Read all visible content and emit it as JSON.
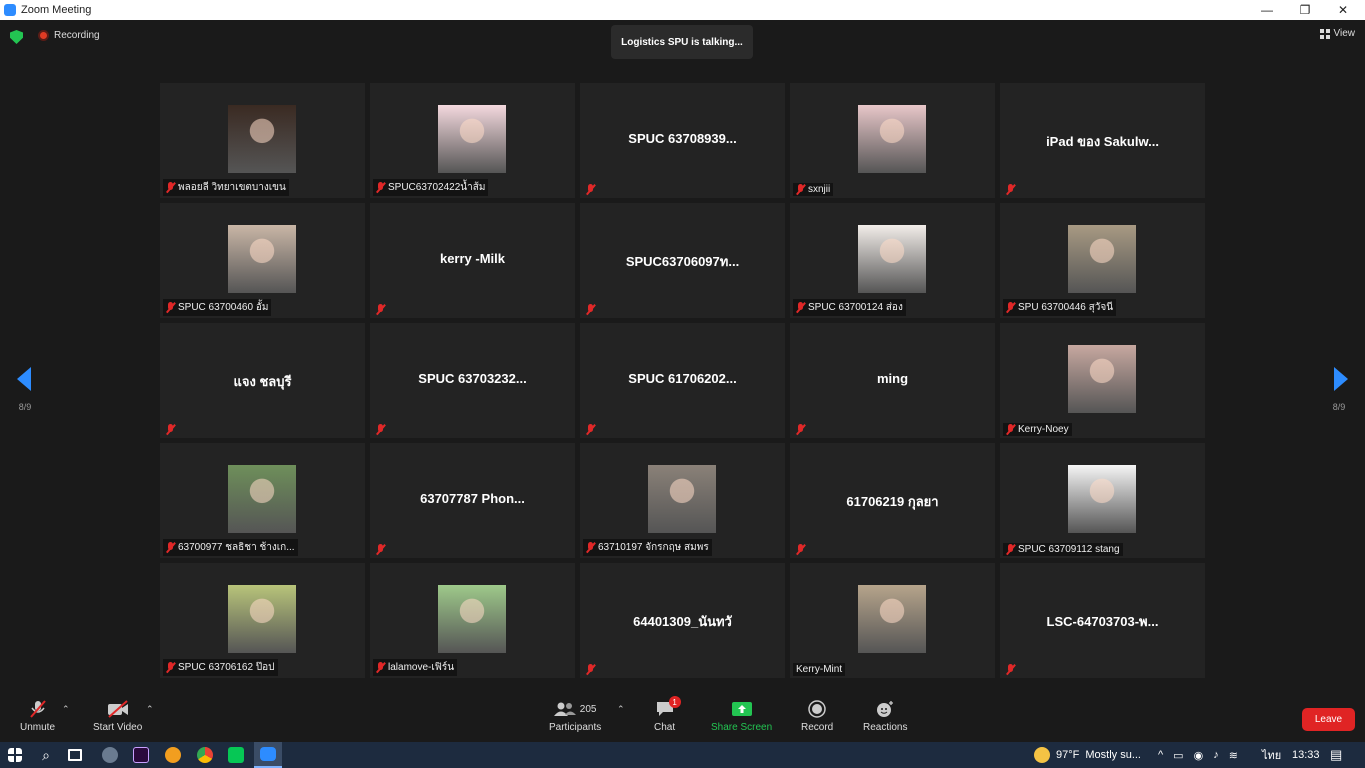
{
  "window": {
    "title": "Zoom Meeting",
    "minimize": "—",
    "restore": "❐",
    "close": "✕"
  },
  "header": {
    "recording_label": "Recording",
    "talking_banner": "Logistics SPU is talking...",
    "view_label": "View"
  },
  "pager": {
    "left_page": "8/9",
    "right_page": "8/9"
  },
  "tiles": [
    {
      "name": "พลอยลี วิทยาเขตบางเขน",
      "muted": true,
      "photo_color": "#3a2a22"
    },
    {
      "name": "SPUC63702422น้ำส้ม",
      "muted": true,
      "photo_color": "#f4d9de"
    },
    {
      "name": "",
      "display_name": "SPUC 63708939...",
      "muted": true
    },
    {
      "name": "sxnjii",
      "muted": true,
      "photo_color": "#e8c7c9"
    },
    {
      "name": "",
      "display_name": "iPad ของ Sakulw...",
      "muted": true
    },
    {
      "name": "SPUC 63700460 อั้ม",
      "muted": true,
      "photo_color": "#c9b6a6"
    },
    {
      "name": "",
      "display_name": "kerry -Milk",
      "muted": true
    },
    {
      "name": "",
      "display_name": "SPUC63706097ท...",
      "muted": true
    },
    {
      "name": "SPUC 63700124 ส่อง",
      "muted": true,
      "photo_color": "#f2ede9"
    },
    {
      "name": "SPU 63700446 สุวัจนี",
      "muted": true,
      "photo_color": "#a89a83"
    },
    {
      "name": "",
      "display_name": "แจง ชลบุรี",
      "muted": true
    },
    {
      "name": "",
      "display_name": "SPUC 63703232...",
      "muted": true
    },
    {
      "name": "",
      "display_name": "SPUC 61706202...",
      "muted": true
    },
    {
      "name": "",
      "display_name": "ming",
      "muted": true
    },
    {
      "name": "Kerry-Noey",
      "muted": true,
      "photo_color": "#c7a8a0"
    },
    {
      "name": "63700977 ชลธิชา ช้างเก...",
      "muted": true,
      "photo_color": "#6e8f5a"
    },
    {
      "name": "",
      "display_name": "63707787 Phon...",
      "muted": true
    },
    {
      "name": "63710197 จักรกฤษ สมพร",
      "muted": true,
      "photo_color": "#8a8178"
    },
    {
      "name": "",
      "display_name": "61706219 กุลยา",
      "muted": true
    },
    {
      "name": "SPUC 63709112 stang",
      "muted": true,
      "photo_color": "#f5f5f5"
    },
    {
      "name": "SPUC 63706162 ป๊อป",
      "muted": true,
      "photo_color": "#b8c47a"
    },
    {
      "name": "lalamove-เฟิร์น",
      "muted": true,
      "photo_color": "#9ec98a"
    },
    {
      "name": "",
      "display_name": "64401309_นันทวั",
      "muted": true
    },
    {
      "name": "Kerry-Mint",
      "muted": false,
      "photo_color": "#b6a48b"
    },
    {
      "name": "",
      "display_name": "LSC-64703703-พ...",
      "muted": true
    }
  ],
  "toolbar": {
    "unmute": "Unmute",
    "start_video": "Start Video",
    "participants": "Participants",
    "participants_count": "205",
    "chat": "Chat",
    "chat_badge": "1",
    "share_screen": "Share Screen",
    "record": "Record",
    "reactions": "Reactions",
    "leave": "Leave"
  },
  "taskbar": {
    "weather_temp": "97°F",
    "weather_text": "Mostly su...",
    "lang": "ไทย",
    "time": "13:33"
  },
  "colors": {
    "accent": "#2d8cff",
    "share_green": "#23c552",
    "leave_red": "#e02424",
    "mute_red": "#e02828"
  }
}
